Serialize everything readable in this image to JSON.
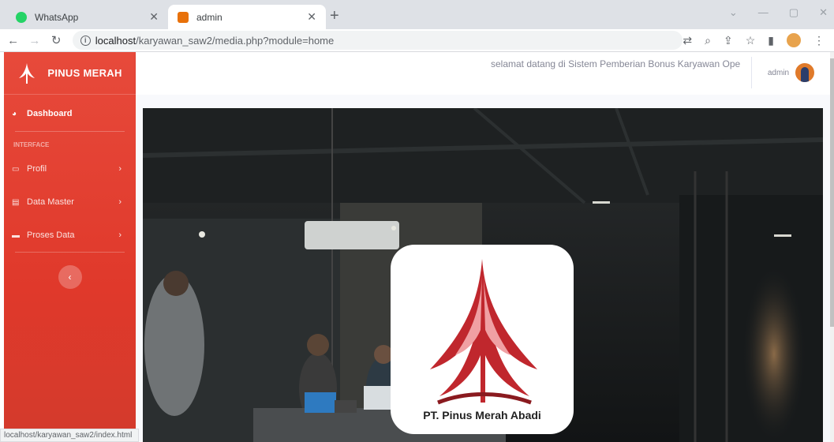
{
  "browser": {
    "tabs": [
      {
        "label": "WhatsApp",
        "active": false
      },
      {
        "label": "admin",
        "active": true
      }
    ],
    "url_host": "localhost",
    "url_path": "/karyawan_saw2/media.php?module=home",
    "status_url": "localhost/karyawan_saw2/index.html"
  },
  "sidebar": {
    "brand": "PINUS MERAH",
    "dashboard_label": "Dashboard",
    "heading": "INTERFACE",
    "items": [
      {
        "label": "Profil",
        "icon": "id-card-icon"
      },
      {
        "label": "Data Master",
        "icon": "database-icon"
      },
      {
        "label": "Proses Data",
        "icon": "folder-icon"
      }
    ],
    "toggle_glyph": "‹"
  },
  "topbar": {
    "welcome_text": "selamat datang di Sistem Pemberian Bonus Karyawan Ope",
    "user_name": "admin"
  },
  "hero": {
    "company_name": "PT. Pinus Merah Abadi"
  },
  "colors": {
    "sidebar_top": "#e74a3b",
    "sidebar_bottom": "#d33a2c",
    "logo_red": "#c0272d"
  }
}
